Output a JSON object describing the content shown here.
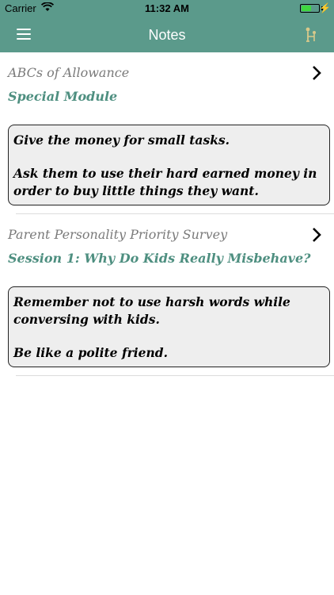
{
  "status_bar": {
    "carrier": "Carrier",
    "time": "11:32 AM"
  },
  "nav": {
    "title": "Notes",
    "menu_icon": "hamburger-menu-icon",
    "right_icon": "family-tree-icon"
  },
  "colors": {
    "nav_bg": "#5b9a8b",
    "module_text": "#4e8f80",
    "course_text": "#7a7a7a",
    "note_bg": "#eeeeee"
  },
  "notes": [
    {
      "course": "ABCs of Allowance",
      "module": "Special Module",
      "lines": [
        "Give the money for small tasks.",
        "Ask them to use their hard earned money in order to buy little things they want."
      ]
    },
    {
      "course": "Parent Personality Priority Survey",
      "module": "Session 1: Why Do Kids Really Misbehave?",
      "lines": [
        "Remember not to use harsh words while conversing with kids.",
        "Be like a polite friend."
      ]
    }
  ]
}
